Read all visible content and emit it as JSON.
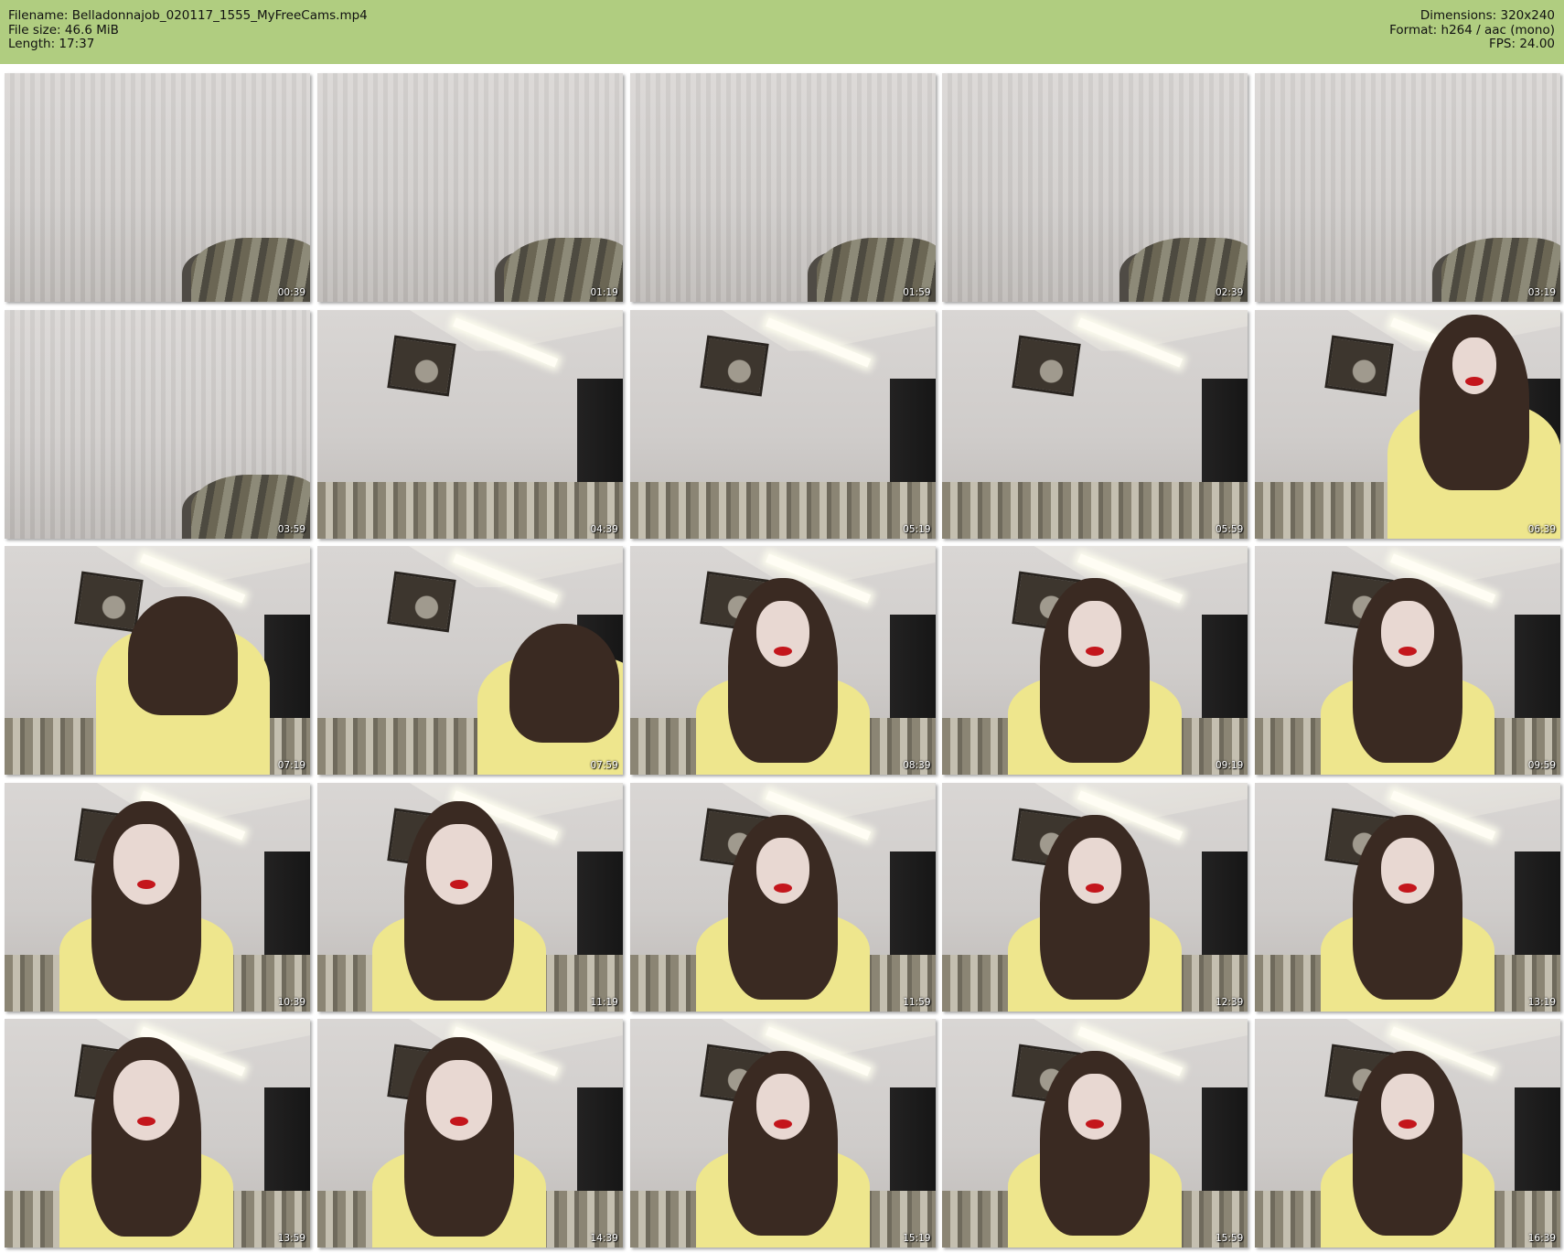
{
  "header": {
    "filename": "Filename: Belladonnajob_020117_1555_MyFreeCams.mp4",
    "filesize": "File size: 46.6 MiB",
    "length": "Length: 17:37",
    "dimensions": "Dimensions: 320x240",
    "format": "Format: h264 / aac (mono)",
    "fps": "FPS: 24.00"
  },
  "colors": {
    "header_bg": "#b0cd80",
    "timestamp_text": "#ffffff"
  },
  "thumbnails": [
    {
      "time": "00:39",
      "scene": "wall",
      "person": "none"
    },
    {
      "time": "01:19",
      "scene": "wall",
      "person": "none"
    },
    {
      "time": "01:59",
      "scene": "wall",
      "person": "none"
    },
    {
      "time": "02:39",
      "scene": "wall",
      "person": "none"
    },
    {
      "time": "03:19",
      "scene": "wall",
      "person": "none"
    },
    {
      "time": "03:59",
      "scene": "wall",
      "person": "none"
    },
    {
      "time": "04:39",
      "scene": "room",
      "person": "none"
    },
    {
      "time": "05:19",
      "scene": "room",
      "person": "none"
    },
    {
      "time": "05:59",
      "scene": "room",
      "person": "none"
    },
    {
      "time": "06:39",
      "scene": "room",
      "person": "right"
    },
    {
      "time": "07:19",
      "scene": "room",
      "person": "lean"
    },
    {
      "time": "07:59",
      "scene": "room",
      "person": "down"
    },
    {
      "time": "08:39",
      "scene": "room",
      "person": "center"
    },
    {
      "time": "09:19",
      "scene": "room",
      "person": "center"
    },
    {
      "time": "09:59",
      "scene": "room",
      "person": "center"
    },
    {
      "time": "10:39",
      "scene": "room",
      "person": "close"
    },
    {
      "time": "11:19",
      "scene": "room",
      "person": "close"
    },
    {
      "time": "11:59",
      "scene": "room",
      "person": "center"
    },
    {
      "time": "12:39",
      "scene": "room",
      "person": "center"
    },
    {
      "time": "13:19",
      "scene": "room",
      "person": "center"
    },
    {
      "time": "13:59",
      "scene": "room",
      "person": "close"
    },
    {
      "time": "14:39",
      "scene": "room",
      "person": "close"
    },
    {
      "time": "15:19",
      "scene": "room",
      "person": "center"
    },
    {
      "time": "15:59",
      "scene": "room",
      "person": "center"
    },
    {
      "time": "16:39",
      "scene": "room",
      "person": "center"
    }
  ]
}
